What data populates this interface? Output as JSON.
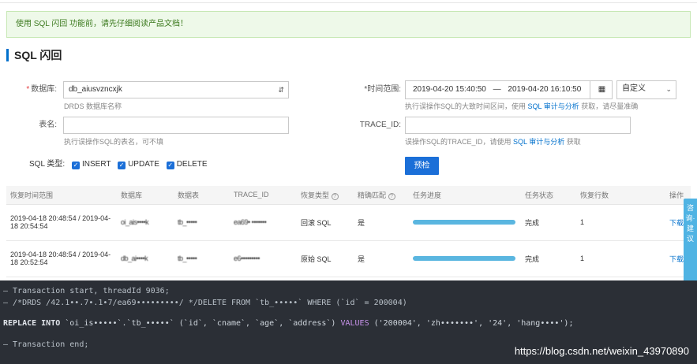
{
  "notice": "使用 SQL 闪回 功能前，请先仔细阅读产品文档！",
  "title": "SQL 闪回",
  "form": {
    "database": {
      "label": "数据库:",
      "value": "db_aiusvzncxjk",
      "hint": "DRDS 数据库名称"
    },
    "table": {
      "label": "表名:",
      "value": "",
      "hint": "执行误操作SQL的表名，可不填"
    },
    "sql_type": {
      "label": "SQL 类型:",
      "options": [
        "INSERT",
        "UPDATE",
        "DELETE"
      ]
    },
    "time_range": {
      "label": "*时间范围:",
      "start": "2019-04-20 15:40:50",
      "separator": "—",
      "end": "2019-04-20 16:10:50",
      "mode": "自定义",
      "hint_prefix": "执行误操作SQL的大致时间区间，使用",
      "hint_link": "SQL 审计与分析",
      "hint_suffix": "获取，请尽量准确"
    },
    "trace_id": {
      "label": "TRACE_ID:",
      "value": "",
      "hint_prefix": "误操作SQL的TRACE_ID，请使用",
      "hint_link": "SQL 审计与分析",
      "hint_suffix": "获取"
    },
    "submit_label": "预检"
  },
  "table": {
    "headers": [
      "恢复时间范围",
      "数据库",
      "数据表",
      "TRACE_ID",
      "恢复类型",
      "精确匹配",
      "任务进度",
      "任务状态",
      "恢复行数",
      "操作"
    ],
    "rows": [
      {
        "time_range": "2019-04-18 20:48:54 / 2019-04-18 20:54:54",
        "database": "oi_ais••••k",
        "table": "tb_•••••",
        "trace_id": "ea69• •••••••",
        "type": "回滚 SQL",
        "exact": "是",
        "progress": 1.0,
        "status": "完成",
        "rows": "1",
        "action": "下载"
      },
      {
        "time_range": "2019-04-18 20:48:54 / 2019-04-18 20:52:54",
        "database": "db_ai••••k",
        "table": "tb_•••••",
        "trace_id": "e6•••••••••",
        "type": "原始 SQL",
        "exact": "是",
        "progress": 1.0,
        "status": "完成",
        "rows": "1",
        "action": "下载"
      }
    ]
  },
  "side_tab": "咨询·建议",
  "console": {
    "line1": "— Transaction start, threadId 9036;",
    "line2": "— /*DRDS /42.1••.7•.1•7/ea69•••••••••/ */DELETE FROM `tb_•••••` WHERE (`id` = 200004)",
    "line3_kw": "REPLACE INTO",
    "line3_rest": " `oi_is•••••`.`tb_•••••` (`id`, `cname`, `age`, `address`) ",
    "line3_values": "VALUES",
    "line3_tail": " ('200004', 'zh•••••••', '24', 'hang••••');",
    "line4": "— Transaction end;"
  },
  "watermark": "https://blog.csdn.net/weixin_43970890"
}
